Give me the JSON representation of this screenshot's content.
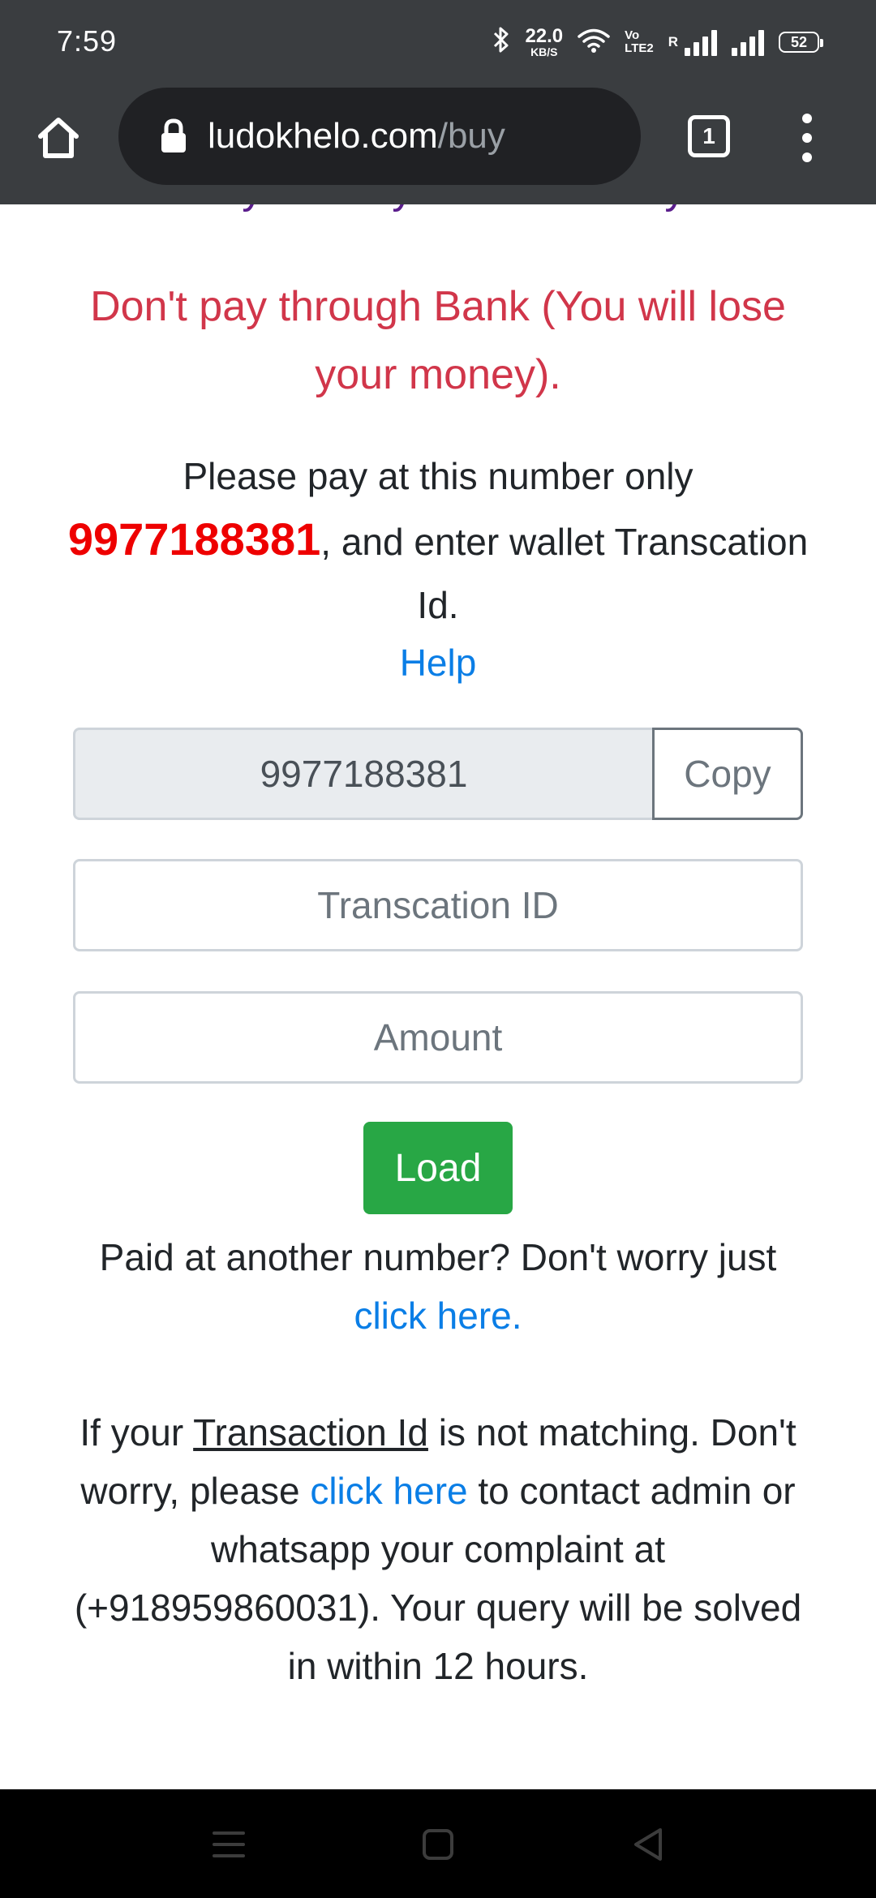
{
  "status_bar": {
    "time": "7:59",
    "net_speed_value": "22.0",
    "net_speed_unit": "KB/S",
    "volte_top": "Vo",
    "volte_bottom": "LTE2",
    "roaming": "R",
    "battery": "52"
  },
  "browser": {
    "url_domain": "ludokhelo.com",
    "url_path": "/buy",
    "tab_count": "1"
  },
  "page": {
    "cut_heading": "Pay via Paytm Wallet Only",
    "warning": "Don't pay through Bank (You will lose your money).",
    "instruction_prefix": "Please pay at this number only",
    "pay_number": "9977188381",
    "instruction_suffix": ", and enter wallet Transcation Id.",
    "help_link": "Help",
    "number_field_value": "9977188381",
    "copy_label": "Copy",
    "txn_placeholder": "Transcation ID",
    "amount_placeholder": "Amount",
    "load_label": "Load",
    "paid_other_text": "Paid at another number? Don't worry just",
    "paid_other_link": "click here.",
    "mismatch_prefix": "If your",
    "mismatch_underlined": "Transaction Id",
    "mismatch_mid": "is not matching. Don't worry, please",
    "mismatch_link": "click here",
    "mismatch_suffix": "to contact admin or whatsapp your complaint at (+918959860031). Your query will be solved in within 12 hours."
  },
  "colors": {
    "warning": "#d1364a",
    "pay_number": "#ee0000",
    "link": "#0a7ee6",
    "load_button": "#28a745",
    "chrome_bar": "#3a3d40"
  },
  "icons": {
    "home": "home-icon",
    "lock": "lock-icon",
    "menu": "more-vert-icon",
    "bluetooth": "bluetooth-icon",
    "wifi": "wifi-icon"
  }
}
